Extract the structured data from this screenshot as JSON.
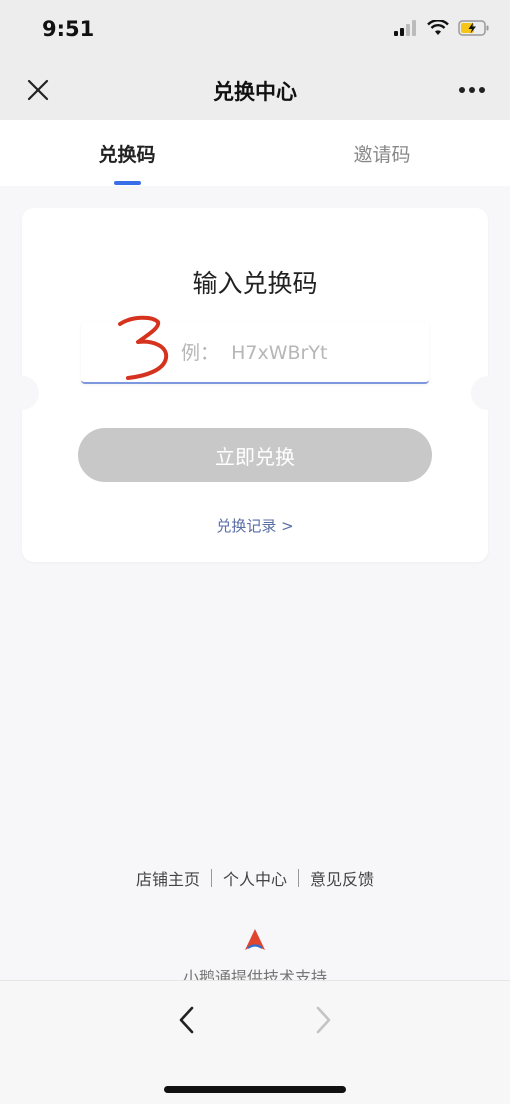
{
  "status_bar": {
    "time": "9:51"
  },
  "nav": {
    "title": "兑换中心"
  },
  "tabs": [
    {
      "label": "兑换码",
      "active": true
    },
    {
      "label": "邀请码",
      "active": false
    }
  ],
  "card": {
    "title": "输入兑换码",
    "input_placeholder": "例：  H7xWBrYt",
    "input_value": "",
    "button_label": "立即兑换",
    "record_link": "兑换记录 >"
  },
  "footer": {
    "links": [
      "店铺主页",
      "个人中心",
      "意见反馈"
    ],
    "support": "小鹅通提供技术支持"
  },
  "colors": {
    "accent": "#3a6ee8",
    "button_disabled": "#c8c8c8",
    "link": "#5a6ea8",
    "brand_logo": "#e0452e",
    "handwriting": "#d6331f"
  },
  "icons": {
    "close": "close-icon",
    "more": "more-icon",
    "back": "chevron-left-icon",
    "forward": "chevron-right-icon"
  }
}
